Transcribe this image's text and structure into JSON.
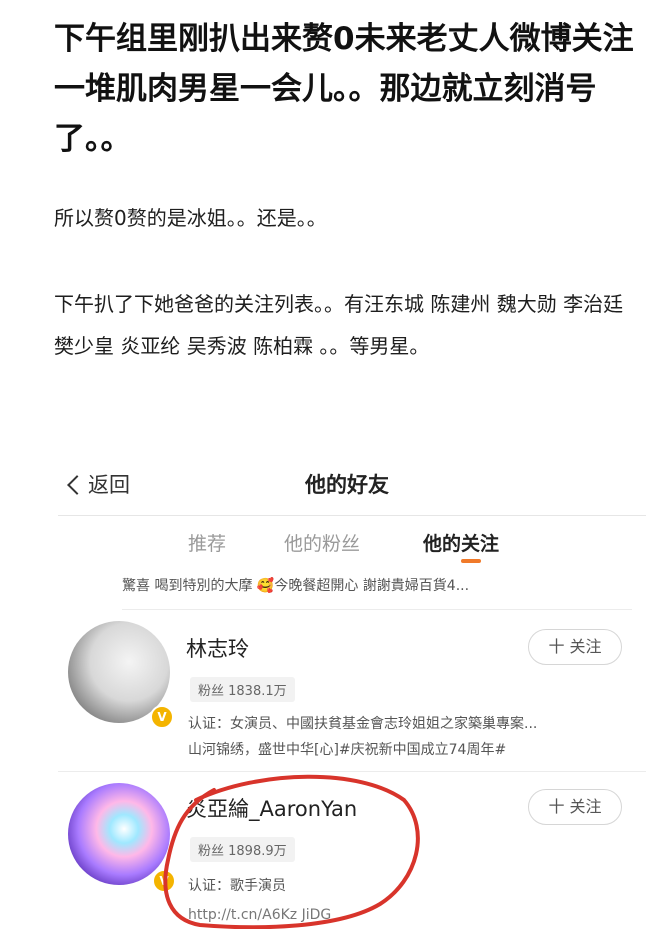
{
  "post": {
    "headline": "下午组里刚扒出来赘0未来老丈人微博关注一堆肌肉男星一会儿。。那边就立刻消号了。。",
    "paragraph1": "所以赘0赘的是冰姐。。还是。。",
    "paragraph2": "下午扒了下她爸爸的关注列表。。有汪东城 陈建州 魏大勋 李治廷 樊少皇 炎亚纶 吴秀波 陈柏霖 。。等男星。"
  },
  "screen": {
    "back_label": "返回",
    "title": "他的好友",
    "tabs": [
      "推荐",
      "他的粉丝",
      "他的关注"
    ],
    "active_tab": "他的关注",
    "cut_text": "驚喜 喝到特別的大摩 🥰今晚餐超開心 謝謝貴婦百貨4...",
    "follow_label": "十 关注",
    "users": [
      {
        "name": "林志玲",
        "fans": "粉丝 1838.1万",
        "verify": "认证：女演员、中國扶貧基金會志玲姐姐之家築巢專案...",
        "sub": "山河锦绣，盛世中华[心]#庆祝新中国成立74周年#"
      },
      {
        "name": "炎亞綸_AaronYan",
        "fans": "粉丝 1898.9万",
        "verify": "认证：歌手演员",
        "sub": "http://t.cn/A6Kz JiDG"
      }
    ],
    "annotation_color": "#d8342b"
  }
}
